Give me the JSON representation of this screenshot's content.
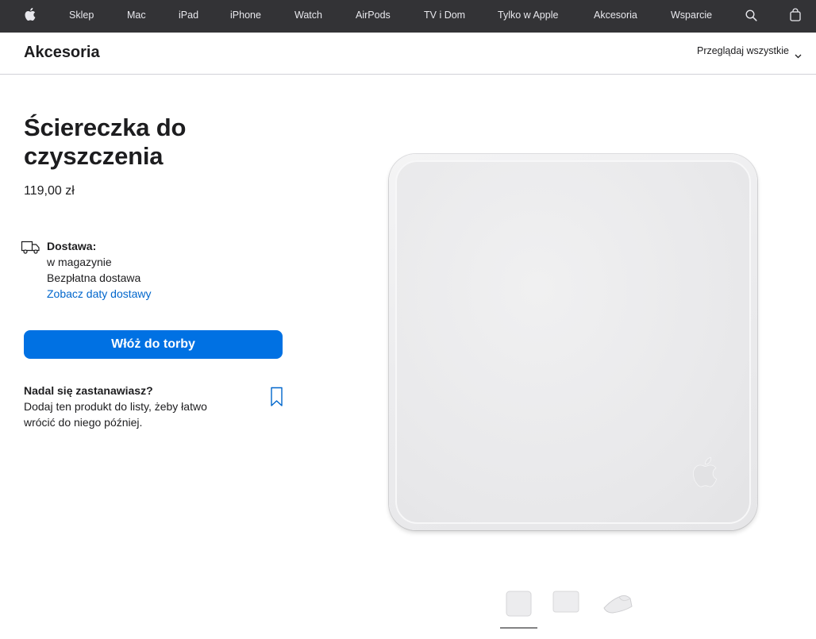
{
  "globalnav": {
    "icons": {
      "logo": "apple-logo-icon",
      "search": "search-icon",
      "bag": "shopping-bag-icon"
    },
    "items": [
      "Sklep",
      "Mac",
      "iPad",
      "iPhone",
      "Watch",
      "AirPods",
      "TV i Dom",
      "Tylko w Apple",
      "Akcesoria",
      "Wsparcie"
    ]
  },
  "localnav": {
    "title": "Akcesoria",
    "browse_label": "Przeglądaj wszystkie"
  },
  "product": {
    "title": "Ściereczka do czyszczenia",
    "price": "119,00 zł",
    "delivery": {
      "icon": "delivery-truck-icon",
      "label": "Dostawa:",
      "availability": "w magazynie",
      "shipping": "Bezpłatna dostawa",
      "link": "Zobacz daty dostawy"
    },
    "add_to_bag_label": "Włóż do torby",
    "save": {
      "icon": "bookmark-icon",
      "title": "Nadal się zastanawiasz?",
      "description": "Dodaj ten produkt do listy, żeby łatwo wrócić do niego później."
    }
  },
  "gallery": {
    "selected_index": 0,
    "thumbnails": [
      "cloth-front",
      "cloth-flat",
      "cloth-folded"
    ]
  },
  "colors": {
    "nav_background": "#333336",
    "accent": "#0071e3",
    "link": "#0066cc",
    "text": "#1d1d1f"
  }
}
